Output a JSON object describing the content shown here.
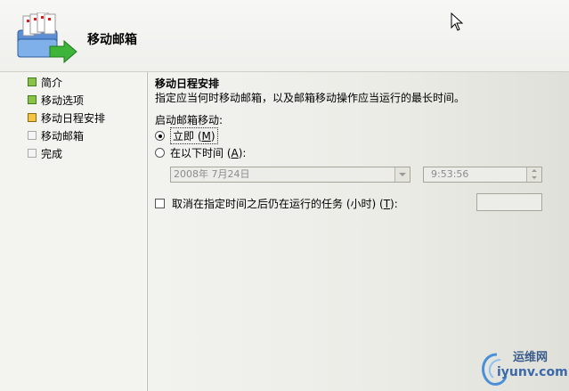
{
  "header": {
    "title": "移动邮箱"
  },
  "steps": [
    {
      "label": "简介",
      "status": "done"
    },
    {
      "label": "移动选项",
      "status": "done"
    },
    {
      "label": "移动日程安排",
      "status": "current"
    },
    {
      "label": "移动邮箱",
      "status": "todo"
    },
    {
      "label": "完成",
      "status": "todo"
    }
  ],
  "main": {
    "section_title": "移动日程安排",
    "section_desc": "指定应当何时移动邮箱，以及邮箱移动操作应当运行的最长时间。",
    "start_label": "启动邮箱移动:",
    "radio_now": {
      "label": "立即 (",
      "accel": "M",
      "label_end": ")",
      "checked": true
    },
    "radio_later": {
      "label": "在以下时间 (",
      "accel": "A",
      "label_end": "):",
      "checked": false
    },
    "date_value": "2008年 7月24日",
    "time_value": "9:53:56",
    "cancel_checkbox": {
      "label": "取消在指定时间之后仍在运行的任务 (小时) (",
      "accel": "T",
      "label_end": "):",
      "checked": false
    },
    "hours_value": ""
  },
  "watermark": {
    "line1": "运维网",
    "line2": "iyunv.com"
  }
}
